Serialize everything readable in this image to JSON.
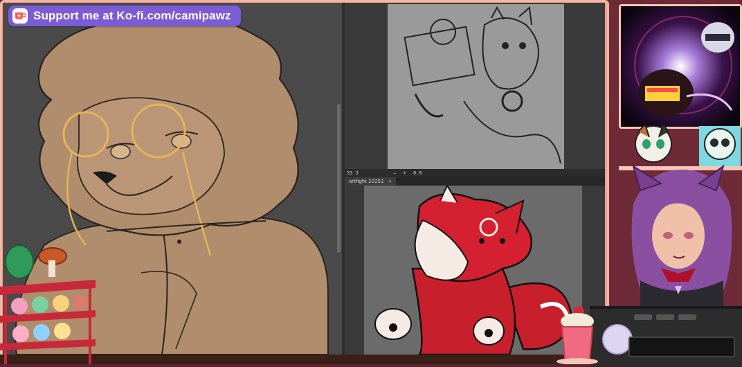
{
  "kofi": {
    "label": "Support me at Ko-fi.com/camipawz",
    "icon": "kofi-cup-icon",
    "color": "#7b5bd6"
  },
  "toolbar": {
    "zoom": "33.3",
    "minus": "–",
    "plus": "+",
    "angle": "0.0"
  },
  "doc_tab": {
    "label": "artfight 20252",
    "close": "×"
  },
  "colors": {
    "brand": "#7b5bd6",
    "frame": "#f6b6a2",
    "accent": "#d4283a"
  }
}
